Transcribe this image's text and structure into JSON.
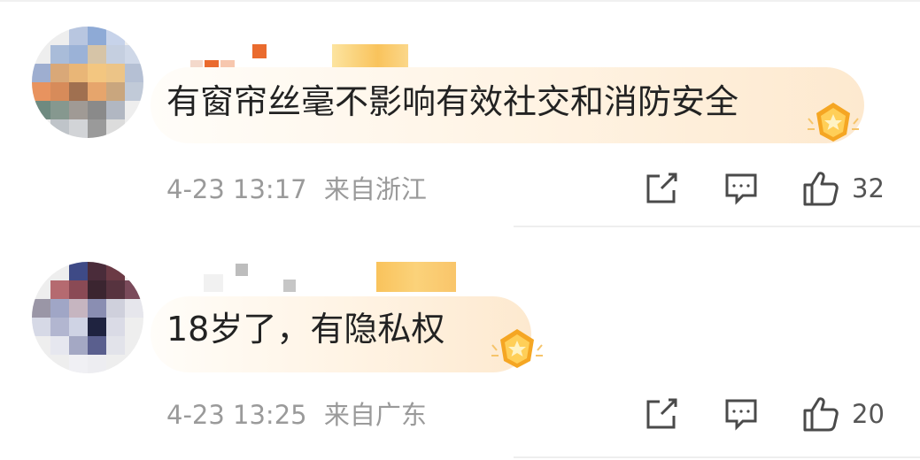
{
  "comments": [
    {
      "text": "有窗帘丝毫不影响有效社交和消防安全",
      "time": "4-23 13:17",
      "location": "来自浙江",
      "likes": "32"
    },
    {
      "text": "18岁了，有隐私权",
      "time": "4-23 13:25",
      "location": "来自广东",
      "likes": "20"
    }
  ],
  "icons": {
    "share": "share-icon",
    "reply": "comment-icon",
    "like": "thumbs-up-icon",
    "badge": "medal-badge-icon"
  },
  "colors": {
    "text": "#222222",
    "meta": "#9a9a9a",
    "icon": "#4a4a4a",
    "badge": "#f5a623"
  }
}
